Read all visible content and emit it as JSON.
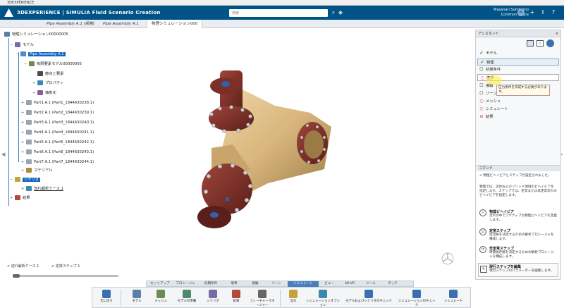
{
  "window": {
    "title": "3DEXPERIENCE"
  },
  "topbar": {
    "brand": "3DEXPERIENCE | SIMULIA Fluid Scenario Creation",
    "search_placeholder": "検索",
    "user_name": "Masanari Sumitomo",
    "user_space": "Common Space",
    "avatar": "PS"
  },
  "tabs": [
    {
      "label": "Pipe Assembly A.1 (探索)"
    },
    {
      "label": "Pipe Assembly A.1"
    },
    {
      "label": "物理シミュレーション000"
    }
  ],
  "tree": {
    "root": "物理シミュレーション00000005",
    "model": "モデル",
    "assembly": "Pipe Assembly A.1",
    "fem": "有限要素モデル00000005",
    "nodes": "節点と要素",
    "props": "プロパティ",
    "abstract": "抽象化",
    "parts": [
      "Part1 A.1 (Part1_1844630238.1)",
      "Part2 A.1 (Part2_1844630239.1)",
      "Part3 A.1 (Part3_1844630240.1)",
      "Part4 A.1 (Part4_1844630241.1)",
      "Part5 A.1 (Part5_1844630242.1)",
      "Part6 A.1 (Part6_1844630243.1)",
      "Part7 A.1 (Part7_1844630244.1)"
    ],
    "material": "マテリアル",
    "scenario": "シナリオ",
    "case": "流れ解析ケース.1",
    "result": "結果"
  },
  "status": {
    "case": "流れ解析ケース.1",
    "step": "定常ステップ.1"
  },
  "assistant": {
    "title": "アシスタント",
    "items": [
      {
        "label": "モデル",
        "state": "done"
      },
      {
        "label": "物理",
        "state": "done"
      },
      {
        "label": "初期条件",
        "state": "todo"
      },
      {
        "label": "境界",
        "state": "error"
      },
      {
        "label": "接触",
        "state": "todo"
      },
      {
        "label": "ゾーン",
        "state": "todo"
      },
      {
        "label": "メッシュ",
        "state": "error"
      },
      {
        "label": "シミュレート",
        "state": "error"
      },
      {
        "label": "結果",
        "state": "blocked"
      }
    ],
    "tooltip": "圧力条件を作成する必要があります。"
  },
  "command": {
    "title": "コマンド",
    "status": "物理ビヘイビアとステップが設定されました。",
    "desc": "物理では、流体およびソリッド領域のビヘイビアを指定します。ステップでは、定常または非定常流れのビヘイビアを指定します。",
    "items": [
      {
        "title": "物理ビヘイビア",
        "text": "流れの中でアクティブな物理ビヘイビアを定義します。"
      },
      {
        "title": "定常ステップ",
        "text": "定常解を決定するための解析プロシージャを構成します。"
      },
      {
        "title": "非定常ステップ",
        "text": "時間依存解を決定するための解析プロシージャを構成します。"
      },
      {
        "title": "現行ステップを編集",
        "text": "現行ステップのパラメーターを編集します。"
      }
    ]
  },
  "workspace_tabs": [
    "セットアップ",
    "プロシージャ",
    "初期条件",
    "境界",
    "接触",
    "ゾーン",
    "シミュレート",
    "ビュー",
    "AR-VR",
    "ツール",
    "タッチ"
  ],
  "workspace_active": "シミュレート",
  "ribbon": [
    {
      "label": "元に戻す",
      "color": "#3a6fb0"
    },
    {
      "label": "モデル",
      "color": "#5b7ea8"
    },
    {
      "label": "メッシュ",
      "color": "#6b8e4e"
    },
    {
      "label": "モデルの準備",
      "color": "#4e8a6b"
    },
    {
      "label": "シナリオ",
      "color": "#7b6aa8"
    },
    {
      "label": "結果",
      "color": "#b04a3a"
    },
    {
      "label": "フィーチャーマネージャー",
      "color": "#666"
    },
    {
      "label": "流力",
      "color": "#c7a23a"
    },
    {
      "label": "シミュレーションオプション",
      "color": "#3a8ab0"
    },
    {
      "label": "モデルおよびシナリオのチェック",
      "color": "#3a6fb0"
    },
    {
      "label": "シミュレーションのチェック",
      "color": "#3a6fb0"
    },
    {
      "label": "シミュレート",
      "color": "#3a6fb0"
    }
  ],
  "colors": {
    "brand": "#005386",
    "pipe": "#d9b77e",
    "flange": "#7b2f26",
    "bolt": "#c9cfd6",
    "port": "#2f5fb0"
  }
}
